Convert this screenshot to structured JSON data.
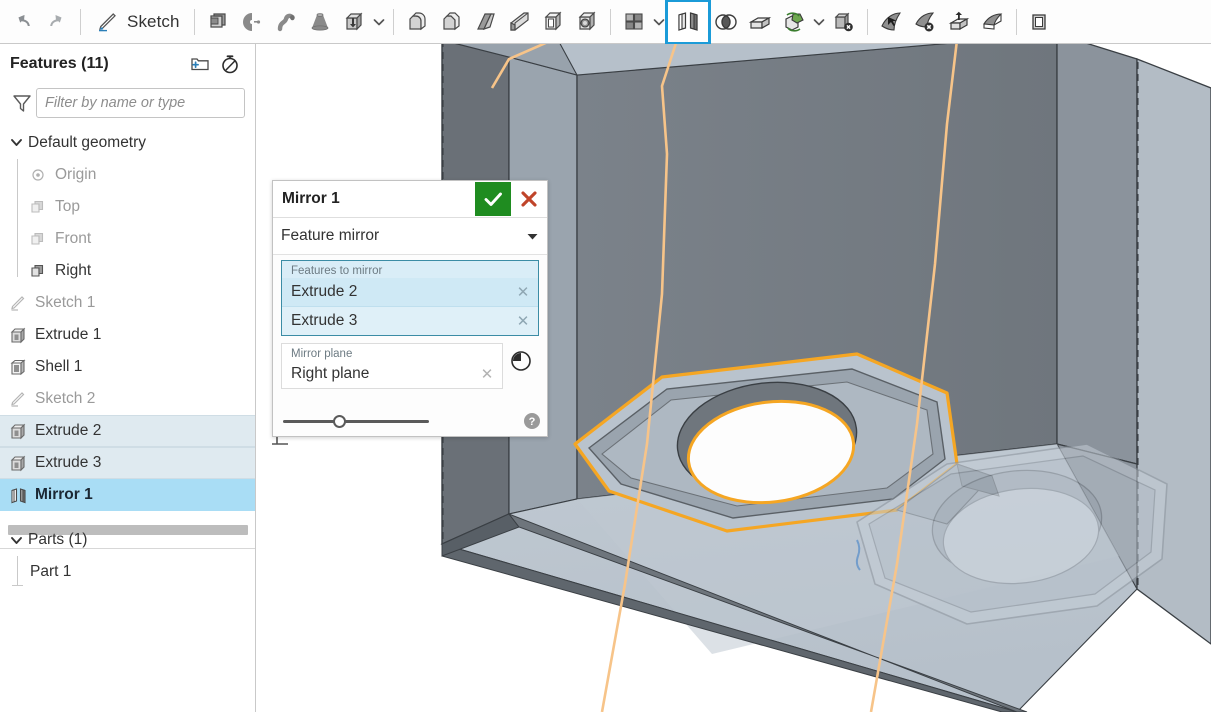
{
  "toolbar": {
    "undo_label": "Undo",
    "redo_label": "Redo",
    "sketch_label": "Sketch",
    "items": [
      {
        "name": "plane-tool",
        "title": "Plane"
      },
      {
        "name": "revolve-tool",
        "title": "Revolve"
      },
      {
        "name": "sweep-tool",
        "title": "Sweep"
      },
      {
        "name": "loft-tool",
        "title": "Loft"
      },
      {
        "name": "extrude-tool",
        "title": "Extrude"
      },
      {
        "name": "fillet-tool",
        "title": "Fillet"
      },
      {
        "name": "chamfer-tool",
        "title": "Chamfer"
      },
      {
        "name": "draft-tool",
        "title": "Draft"
      },
      {
        "name": "rib-tool",
        "title": "Rib"
      },
      {
        "name": "shell-tool",
        "title": "Shell"
      },
      {
        "name": "hole-tool",
        "title": "Hole"
      },
      {
        "name": "pattern-tool",
        "title": "Pattern"
      },
      {
        "name": "mirror-tool",
        "title": "Mirror",
        "selected": true
      },
      {
        "name": "boolean-tool",
        "title": "Boolean"
      },
      {
        "name": "split-tool",
        "title": "Split"
      },
      {
        "name": "transform-tool",
        "title": "Transform"
      },
      {
        "name": "delete-part-tool",
        "title": "Delete part"
      },
      {
        "name": "move-face-tool",
        "title": "Move face"
      },
      {
        "name": "delete-face-tool",
        "title": "Delete face"
      },
      {
        "name": "replace-face-tool",
        "title": "Replace face"
      },
      {
        "name": "thicken-tool",
        "title": "Thicken"
      },
      {
        "name": "enclose-tool",
        "title": "Enclose"
      }
    ]
  },
  "features_panel": {
    "title": "Features (11)",
    "new_folder_icon": "new-folder-icon",
    "rollback_icon": "stopwatch-icon",
    "filter_icon": "funnel-icon",
    "filter_placeholder": "Filter by name or type",
    "filter_value": "",
    "tree": [
      {
        "label": "Default geometry",
        "icon": "chevron-down-icon",
        "type": "group",
        "state": "normal",
        "indent": 0
      },
      {
        "label": "Origin",
        "icon": "origin-icon",
        "type": "item",
        "state": "dim",
        "indent": 1
      },
      {
        "label": "Top",
        "icon": "plane-icon",
        "type": "item",
        "state": "dim",
        "indent": 1
      },
      {
        "label": "Front",
        "icon": "plane-icon",
        "type": "item",
        "state": "dim",
        "indent": 1
      },
      {
        "label": "Right",
        "icon": "plane-icon",
        "type": "item",
        "state": "normal",
        "indent": 1
      },
      {
        "label": "Sketch 1",
        "icon": "sketch-icon",
        "type": "item",
        "state": "dim",
        "indent": 0
      },
      {
        "label": "Extrude 1",
        "icon": "extrude-icon",
        "type": "item",
        "state": "normal",
        "indent": 0
      },
      {
        "label": "Shell 1",
        "icon": "shell-icon",
        "type": "item",
        "state": "normal",
        "indent": 0
      },
      {
        "label": "Sketch 2",
        "icon": "sketch-icon",
        "type": "item",
        "state": "dim",
        "indent": 0
      },
      {
        "label": "Extrude 2",
        "icon": "extrude-icon",
        "type": "item",
        "state": "sel-soft",
        "indent": 0
      },
      {
        "label": "Extrude 3",
        "icon": "extrude-icon",
        "type": "item",
        "state": "sel-soft",
        "indent": 0
      },
      {
        "label": "Mirror 1",
        "icon": "mirror-icon",
        "type": "item",
        "state": "sel-strong",
        "indent": 0
      }
    ],
    "parts": {
      "header": "Parts (1)",
      "items": [
        {
          "label": "Part 1"
        }
      ]
    }
  },
  "dialog": {
    "title": "Mirror 1",
    "accept_icon": "checkmark-icon",
    "cancel_icon": "close-icon",
    "type_value": "Feature mirror",
    "type_caret_icon": "caret-down-icon",
    "features_field": {
      "caption": "Features to mirror",
      "chips": [
        {
          "label": "Extrude 2",
          "remove_icon": "remove-icon"
        },
        {
          "label": "Extrude 3",
          "remove_icon": "remove-icon"
        }
      ]
    },
    "plane_field": {
      "caption": "Mirror plane",
      "value": "Right plane",
      "remove_icon": "remove-icon"
    },
    "history_icon": "history-clock-icon",
    "help_icon": "help-icon",
    "opacity_slider": {
      "value": 34,
      "min": 0,
      "max": 100
    }
  },
  "viewport": {
    "rollback_handle": "rollback-bar-handle",
    "colors": {
      "highlight": "#f5a623",
      "mirror_plane_line": "#f7c489",
      "face_light": "#b8c2cc",
      "face_mid": "#8d949c",
      "face_dark": "#6b7177",
      "face_darkest": "#5a6066",
      "edge": "#3a3f44",
      "background": "#ffffff"
    }
  }
}
